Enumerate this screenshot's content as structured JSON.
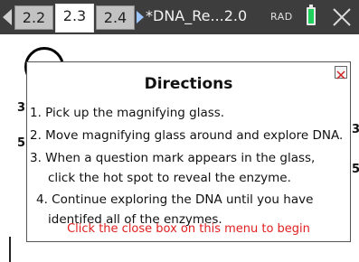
{
  "tabs": [
    {
      "label": "2.2"
    },
    {
      "label": "2.3"
    },
    {
      "label": "2.4"
    }
  ],
  "document_title": "*DNA_Re...2.0",
  "angle_mode": "RAD",
  "side_labels": {
    "left_a": "3",
    "left_b": "5",
    "right_a": "3'",
    "right_b": "5'"
  },
  "directions": {
    "title": "Directions",
    "steps": [
      "1. Pick up the magnifying glass.",
      "2. Move magnifying glass around and explore DNA.",
      "3. When a question mark appears in the glass,",
      "click the hot spot to reveal the enzyme.",
      "4. Continue exploring the DNA until you have",
      "identifed all of the enzymes."
    ],
    "footer": "Click the close box on this menu to begin"
  },
  "colors": {
    "topbar": "#3d3d3d",
    "footer_text": "#e02020",
    "battery": "#1fd05c"
  }
}
